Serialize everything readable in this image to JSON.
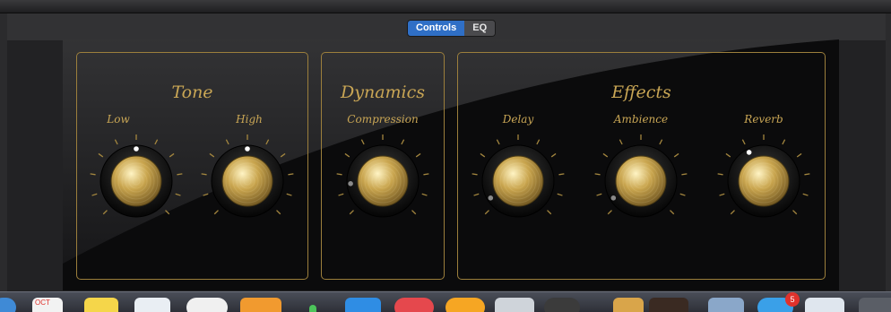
{
  "header": {
    "tabs": [
      {
        "label": "Controls",
        "active": true
      },
      {
        "label": "EQ",
        "active": false
      }
    ]
  },
  "sections": [
    {
      "title": "Tone",
      "knobs": [
        {
          "label": "Low",
          "value": 0.5
        },
        {
          "label": "High",
          "value": 0.5
        }
      ]
    },
    {
      "title": "Dynamics",
      "knobs": [
        {
          "label": "Compression",
          "value": 0.15
        }
      ]
    },
    {
      "title": "Effects",
      "knobs": [
        {
          "label": "Delay",
          "value": 0.05
        },
        {
          "label": "Ambience",
          "value": 0.05
        },
        {
          "label": "Reverb",
          "value": 0.4
        }
      ]
    }
  ],
  "dock": {
    "calendar_month": "OCT",
    "mail_badge": "5"
  },
  "colors": {
    "gold": "#c9a655",
    "section_border": "#9c7f3c",
    "active_tab": "#2f6fc6",
    "panel": "#0b0b0c"
  }
}
